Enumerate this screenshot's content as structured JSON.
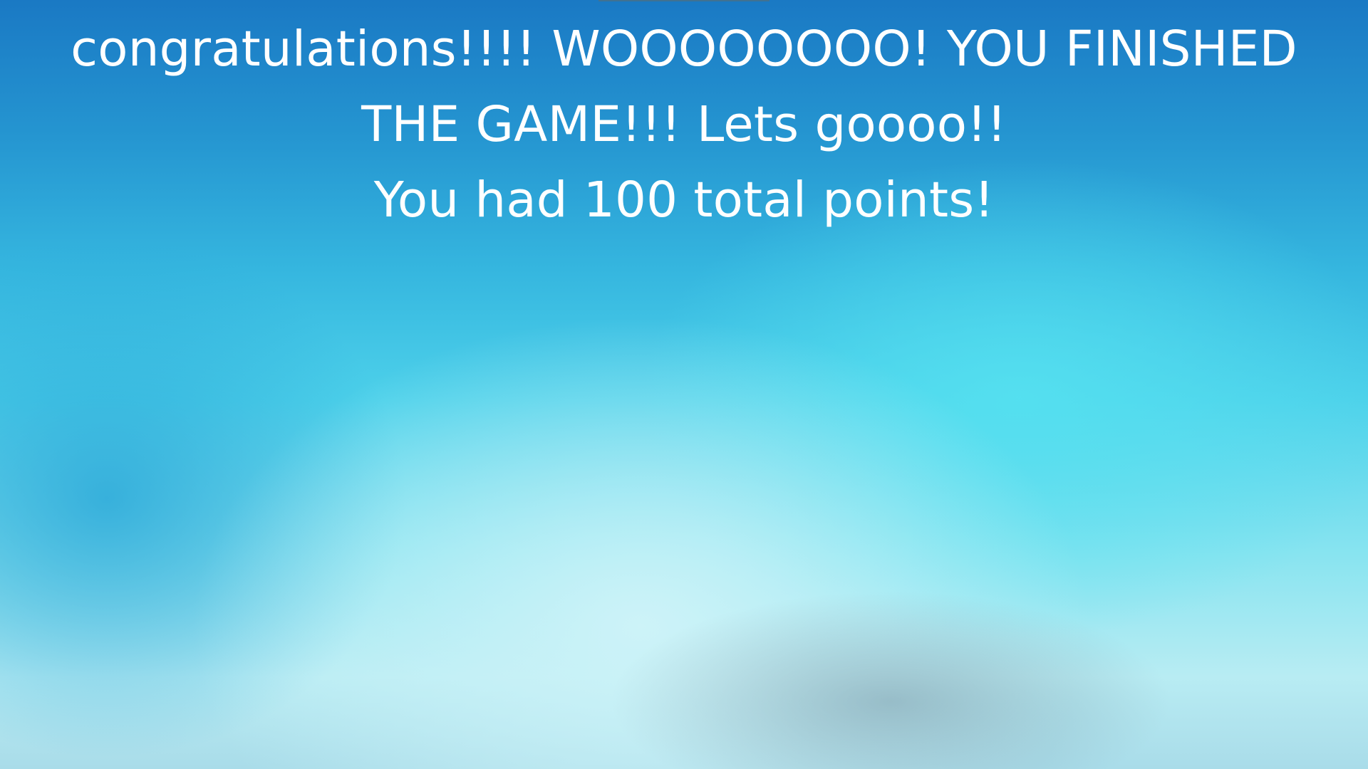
{
  "end_screen": {
    "congrats_message": "congratulations!!!! WOOOOOOOO! YOU FINISHED THE GAME!!! Lets goooo!!",
    "score_message": "You had 100 total points!"
  },
  "colors": {
    "text": "#ffffff",
    "background_top": "#1a79c4",
    "background_bottom": "#a9dce9"
  }
}
